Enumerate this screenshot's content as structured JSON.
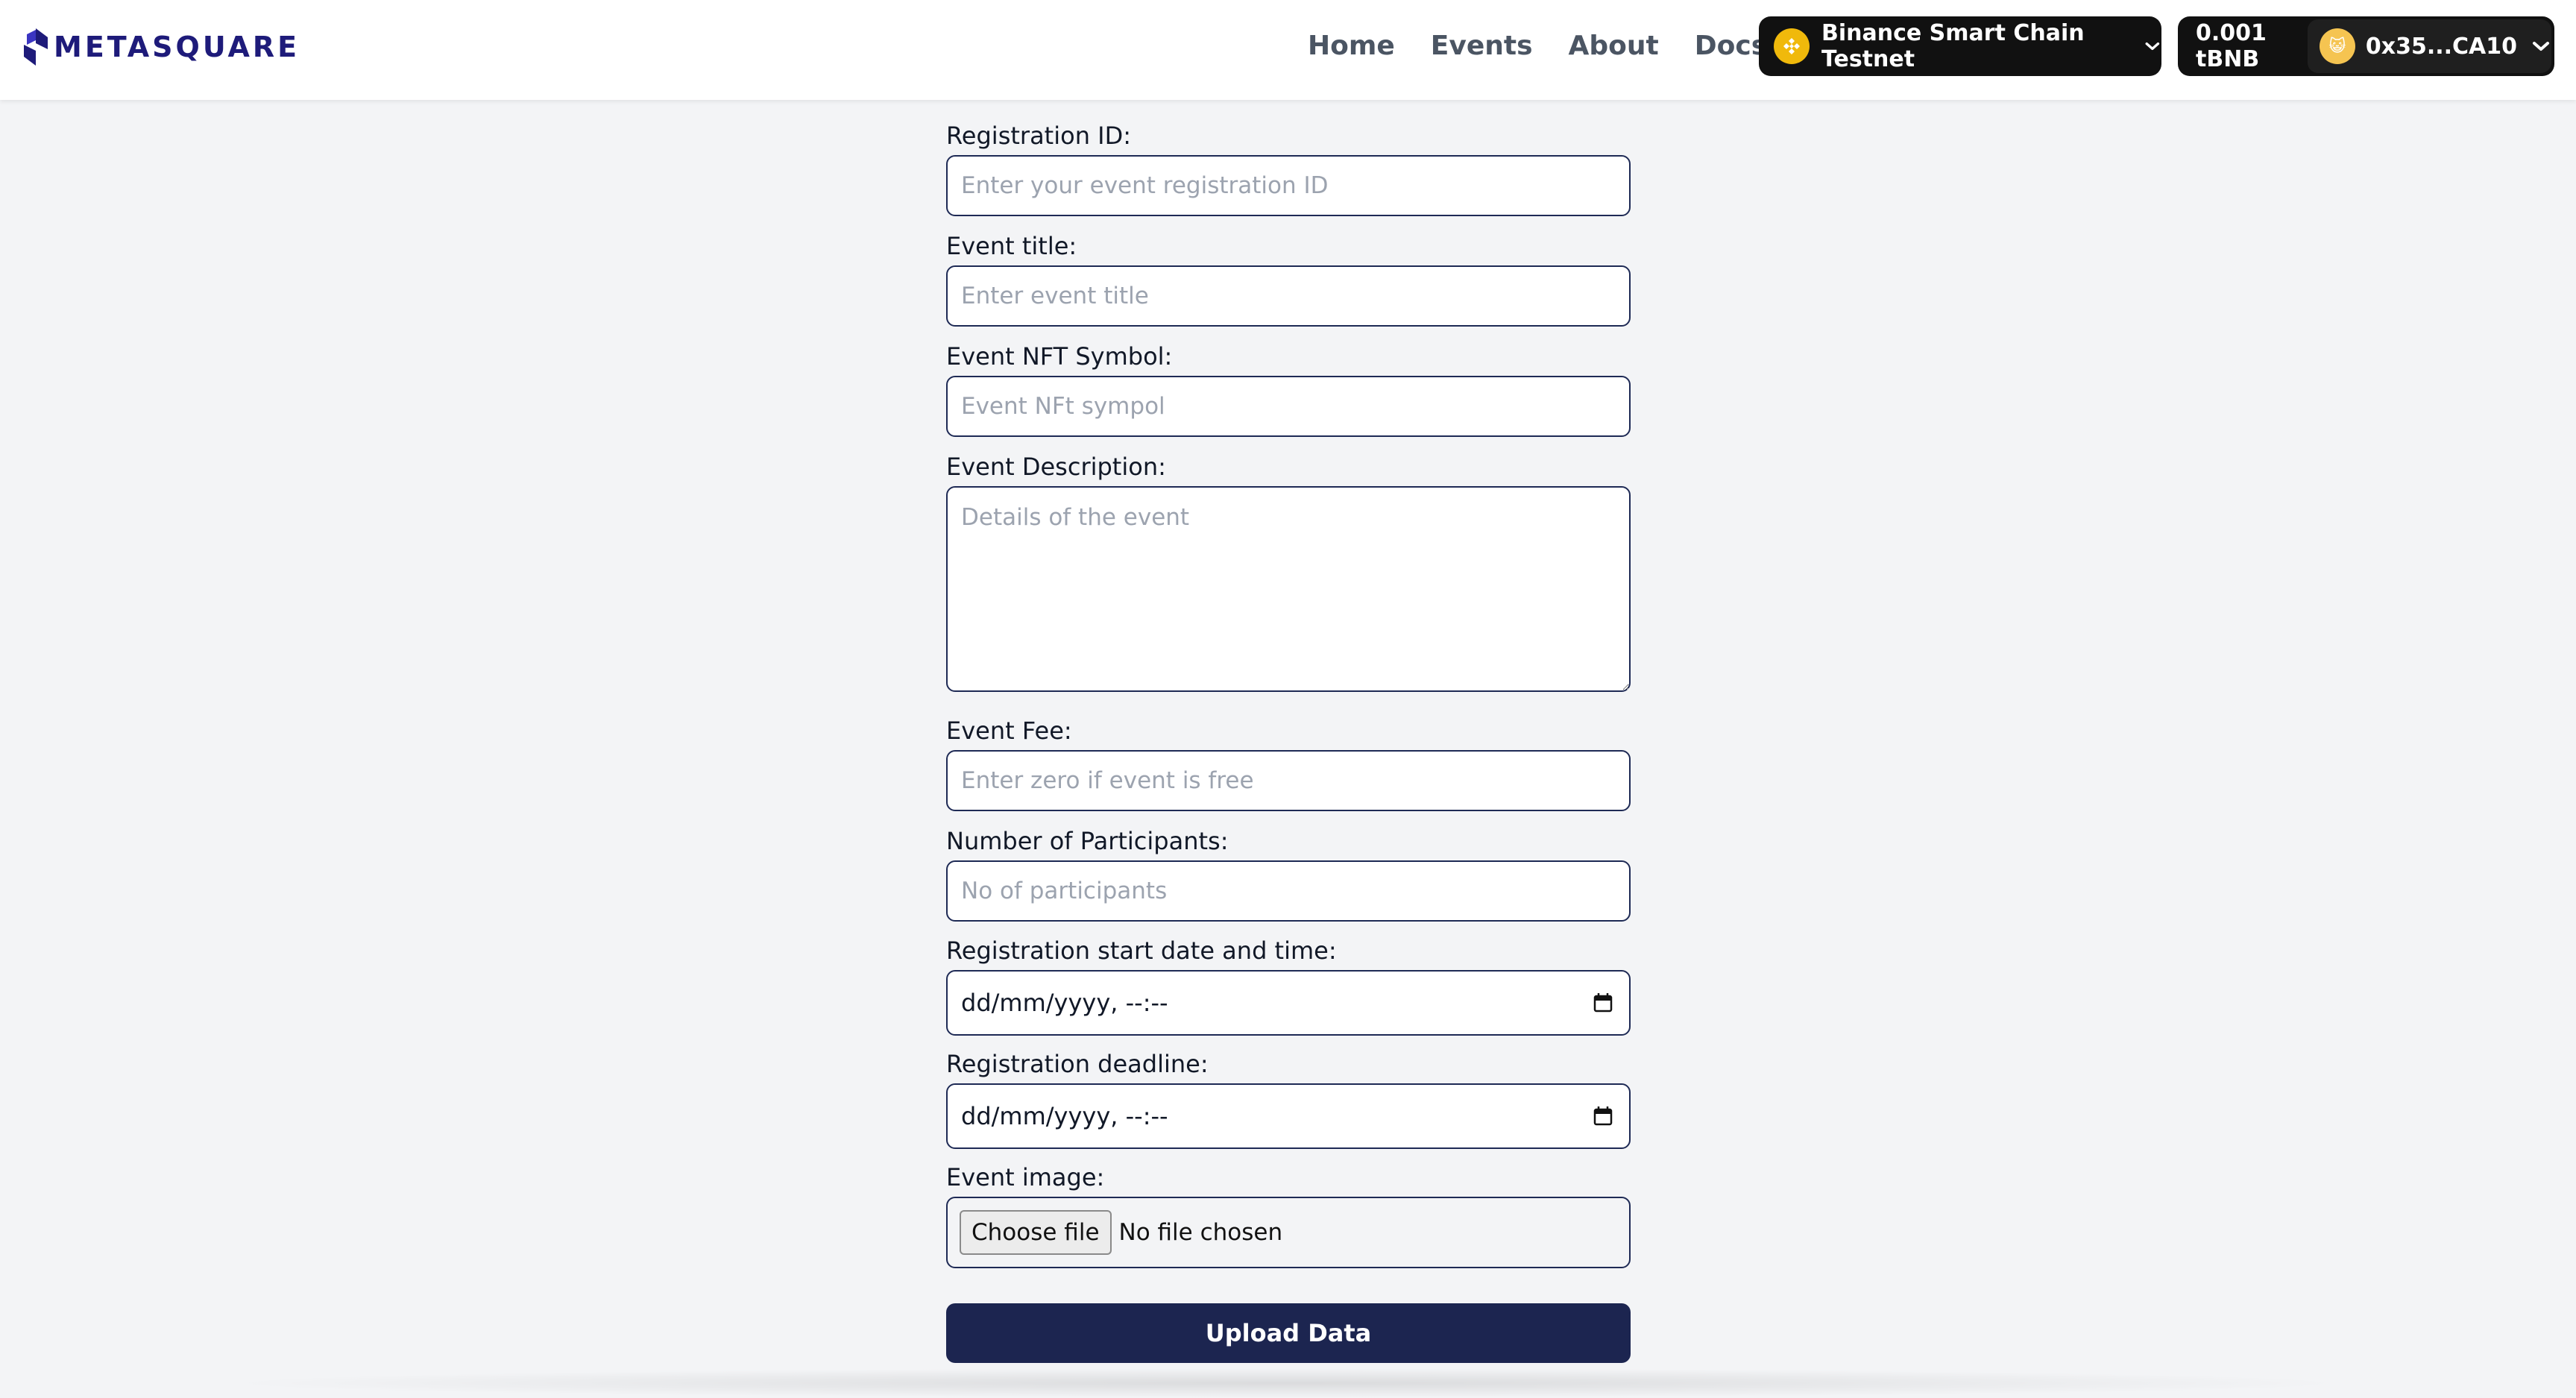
{
  "header": {
    "brand": "METASQUARE",
    "nav": [
      "Home",
      "Events",
      "About",
      "Docs"
    ],
    "chain_label": "Binance Smart Chain Testnet",
    "balance": "0.001 tBNB",
    "address": "0x35...CA10"
  },
  "form": {
    "registration_id": {
      "label": "Registration ID:",
      "placeholder": "Enter your event registration ID"
    },
    "event_title": {
      "label": "Event title:",
      "placeholder": "Enter event title"
    },
    "nft_symbol": {
      "label": "Event NFT Symbol:",
      "placeholder": "Event NFt sympol"
    },
    "description": {
      "label": "Event Description:",
      "placeholder": "Details of the event"
    },
    "fee": {
      "label": "Event Fee:",
      "placeholder": "Enter zero if event is free"
    },
    "participants": {
      "label": "Number of Participants:",
      "placeholder": "No of participants"
    },
    "start": {
      "label": "Registration start date and time:",
      "value": "dd/mm/yyyy, --:--"
    },
    "deadline": {
      "label": "Registration deadline:",
      "value": "dd/mm/yyyy, --:--"
    },
    "image": {
      "label": "Event image:",
      "button": "Choose file",
      "status": "No file chosen"
    },
    "submit": "Upload Data"
  }
}
